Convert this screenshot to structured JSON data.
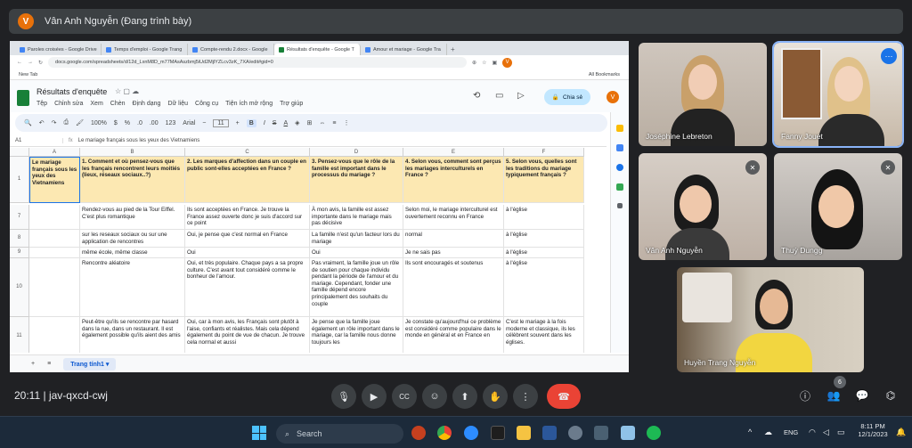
{
  "meet": {
    "presenter_initial": "V",
    "presenting_title": "Vân Anh Nguyễn (Đang trình bày)",
    "meeting_time": "20:11",
    "meeting_code": "jav-qxcd-cwj",
    "participant_count": "6",
    "participants": [
      {
        "name": "Joséphine Lebreton"
      },
      {
        "name": "Fanny Jouet"
      },
      {
        "name": "Vân Anh Nguyễn"
      },
      {
        "name": "Thuỳ Dungg"
      },
      {
        "name": "Huyền Trang Nguyễn"
      }
    ]
  },
  "browser": {
    "tabs": [
      {
        "label": "Paroles croisées - Google Drive"
      },
      {
        "label": "Temps d'emploi - Google Trang"
      },
      {
        "label": "Compte-rendu 2.docx - Google"
      },
      {
        "label": "Résultats d'enquête - Google T"
      },
      {
        "label": "Amour et mariage - Google Tra"
      }
    ],
    "url": "docs.google.com/spreadsheets/d/12d_LxnM8D_m77MAsAszbmj5iUd2MjlYZLcv3zK_7XA/edit#gid=0",
    "bookmark_newtab": "New Tab",
    "all_bookmarks": "All Bookmarks",
    "user_initial": "V"
  },
  "sheets": {
    "title": "Résultats d'enquête",
    "menus": [
      "Tệp",
      "Chỉnh sửa",
      "Xem",
      "Chèn",
      "Định dạng",
      "Dữ liệu",
      "Công cụ",
      "Tiện ích mở rộng",
      "Trợ giúp"
    ],
    "share_label": "Chia sẻ",
    "zoom": "100%",
    "font": "Arial",
    "font_size": "11",
    "bold": "B",
    "italic": "I",
    "strike": "S",
    "text_color": "A",
    "currency": "$",
    "percent": "%",
    "dec_less": ".0",
    "dec_more": ".00",
    "num_format": "123",
    "cell_ref": "A1",
    "formula": "Le mariage français sous les yeux des Vietnamiens",
    "sheet_tab": "Trang tính1",
    "col_letters": [
      "A",
      "B",
      "C",
      "D",
      "E",
      "F"
    ],
    "header_row_num": "1",
    "headers": [
      "Le mariage français sous les yeux des Vietnamiens",
      "1. Comment et où pensez-vous que les français rencontrent leurs moitiés (lieux, réseaux sociaux..?)",
      "2. Les marques d'affection dans un couple en public sont-elles acceptées en France ?",
      "3. Pensez-vous que le rôle de la famille est important dans le processus du mariage ?",
      "4. Selon vous, comment sont perçus les mariages interculturels en France ?",
      "5. Selon vous, quelles sont les traditions du mariage typiquement français ?"
    ],
    "rows": [
      {
        "num": "7",
        "cells": [
          "",
          "Rendez-vous au pied de la Tour Eiffel. C'est plus romantique",
          "Ils sont acceptées en France. Je trouve la France assez ouverte donc je suis d'accord sur ce point",
          "À mon avis, la famille est assez importante dans le mariage mais pas décisive",
          "Selon moi, le mariage interculturel est ouvertement reconnu en France",
          "à l'église"
        ]
      },
      {
        "num": "8",
        "cells": [
          "",
          "sur les reseaux sociaux ou sur une application de rencontres",
          "Oui, je pense que c'est normal en France",
          "La famille n'est qu'un facteur lors du mariage",
          "normal",
          "à l'église"
        ]
      },
      {
        "num": "9",
        "cells": [
          "",
          "même école, même classe",
          "Oui",
          "Oui",
          "Je ne sais pas",
          "à l'église"
        ]
      },
      {
        "num": "10",
        "cells": [
          "",
          "Rencontre aléatoire",
          "Oui, et très populaire.  Chaque pays a sa propre culture. C'est avant tout considéré comme le bonheur de l'amour.",
          "Pas vraiment, la famille joue un rôle de soutien pour chaque individu pendant la période de l'amour et du mariage. Cependant, fonder une famille dépend encore principalement des souhaits du couple",
          "Ils sont encouragés et soutenus",
          "à l'église"
        ]
      },
      {
        "num": "11",
        "cells": [
          "",
          "Peut-être qu'ils se rencontre par hasard dans la rue, dans un restaurant. Il est également possible qu'ils aient des amis",
          "Oui, car à mon avis, les Français sont plutôt à l'aise, confiants et réalistes. Mais cela dépend également du point de vue de chacun. Je trouve cela normal et aussi",
          "Je pense que la famille joue également un rôle important dans le mariage, car la famille nous donne toujours les",
          "Je constate qu'aujourd'hui ce problème est considéré comme populaire dans le monde en général et en France en",
          " C'est le mariage à la fois moderne et classique, ils les célèbrent souvent dans les églises."
        ]
      }
    ]
  },
  "taskbar": {
    "search_label": "Search",
    "lang": "ENG",
    "time": "8:11 PM",
    "date": "12/1/2023"
  },
  "colors": {
    "header_fill": "#fce8b2",
    "meet_bg": "#202124",
    "hangup": "#ea4335",
    "accent": "#1a73e8"
  }
}
